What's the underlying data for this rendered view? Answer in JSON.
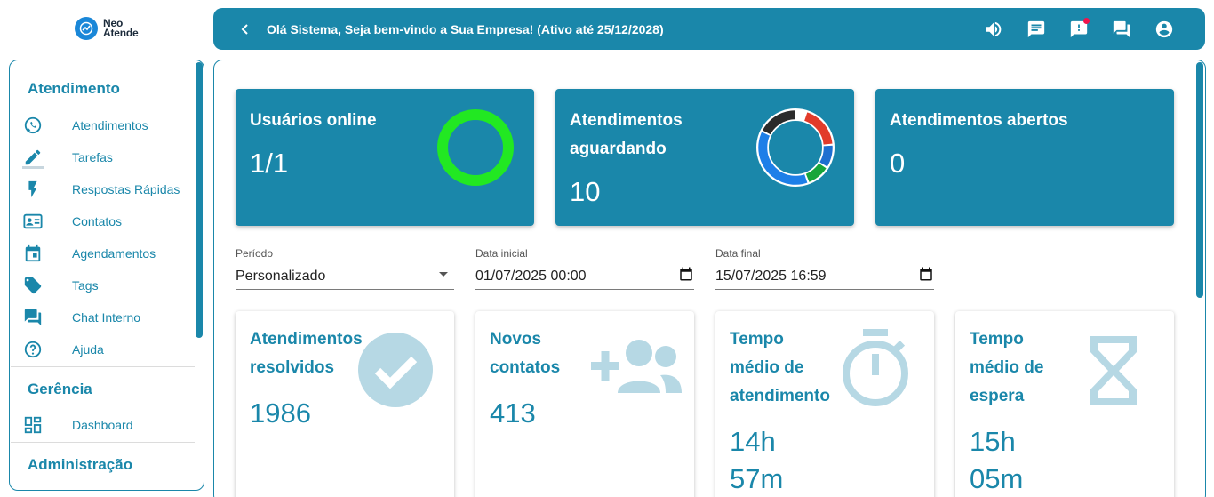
{
  "logo": {
    "line1": "Neo",
    "line2": "Atende"
  },
  "topbar": {
    "greeting": "Olá Sistema, Seja bem-vindo a Sua Empresa! (Ativo até 25/12/2028)",
    "icons": [
      "volume-icon",
      "chat-icon",
      "alert-icon",
      "forum-icon",
      "account-icon"
    ]
  },
  "sidebar": {
    "section_atendimento": "Atendimento",
    "items": [
      {
        "label": "Atendimentos",
        "icon": "whatsapp-icon"
      },
      {
        "label": "Tarefas",
        "icon": "pencil-icon"
      },
      {
        "label": "Respostas Rápidas",
        "icon": "flash-icon"
      },
      {
        "label": "Contatos",
        "icon": "contacts-icon"
      },
      {
        "label": "Agendamentos",
        "icon": "calendar-icon"
      },
      {
        "label": "Tags",
        "icon": "tag-icon"
      },
      {
        "label": "Chat Interno",
        "icon": "forum-icon"
      },
      {
        "label": "Ajuda",
        "icon": "help-icon"
      }
    ],
    "section_gerencia": "Gerência",
    "gerencia_items": [
      {
        "label": "Dashboard",
        "icon": "dashboard-icon"
      }
    ],
    "section_admin": "Administração"
  },
  "kpis": [
    {
      "title": "Usuários online",
      "value": "1/1"
    },
    {
      "title": "Atendimentos aguardando",
      "value": "10"
    },
    {
      "title": "Atendimentos abertos",
      "value": "0"
    }
  ],
  "filters": {
    "period_label": "Período",
    "period_value": "Personalizado",
    "start_label": "Data inicial",
    "start_value": "01/07/2025 00:00",
    "end_label": "Data final",
    "end_value": "15/07/2025 16:59"
  },
  "stats": [
    {
      "title_l1": "Atendimentos",
      "title_l2": "resolvidos",
      "value": "1986"
    },
    {
      "title_l1": "Novos",
      "title_l2": "contatos",
      "value": "413"
    },
    {
      "title_l1": "Tempo",
      "title_l2": "médio de",
      "title_l3": "atendimento",
      "value_l1": "14h",
      "value_l2": "57m"
    },
    {
      "title_l1": "Tempo",
      "title_l2": "médio de",
      "title_l3": "espera",
      "value_l1": "15h",
      "value_l2": "05m"
    }
  ],
  "colors": {
    "primary": "#1a87aa",
    "online_ring": "#22e822",
    "icon_light": "#b6d8e4"
  }
}
